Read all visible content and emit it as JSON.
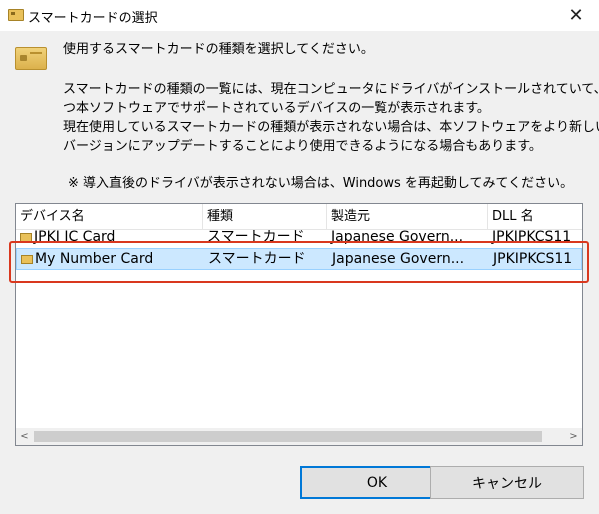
{
  "window": {
    "title": "スマートカードの選択",
    "close_glyph": "✕"
  },
  "message": {
    "line1": "使用するスマートカードの種類を選択してください。",
    "line2": "スマートカードの種類の一覧には、現在コンピュータにドライバがインストールされていて、か",
    "line3": "つ本ソフトウェアでサポートされているデバイスの一覧が表示されます。",
    "line4": "現在使用しているスマートカードの種類が表示されない場合は、本ソフトウェアをより新しい",
    "line5": "バージョンにアップデートすることにより使用できるようになる場合もあります。",
    "note": "※ 導入直後のドライバが表示されない場合は、Windows を再起動してみてください。"
  },
  "list": {
    "columns": [
      "デバイス名",
      "種類",
      "製造元",
      "DLL 名"
    ],
    "rows": [
      {
        "device": "JPKI IC Card",
        "type": "スマートカード",
        "maker": "Japanese Govern...",
        "dll": "JPKIPKCS11"
      },
      {
        "device": "My Number Card",
        "type": "スマートカード",
        "maker": "Japanese Govern...",
        "dll": "JPKIPKCS11"
      }
    ],
    "scroll_left": "<",
    "scroll_right": ">"
  },
  "buttons": {
    "ok": "OK",
    "cancel": "キャンセル"
  },
  "colors": {
    "selection": "#cce8ff",
    "highlight_border": "#d9381e",
    "ok_border": "#0078d7"
  }
}
